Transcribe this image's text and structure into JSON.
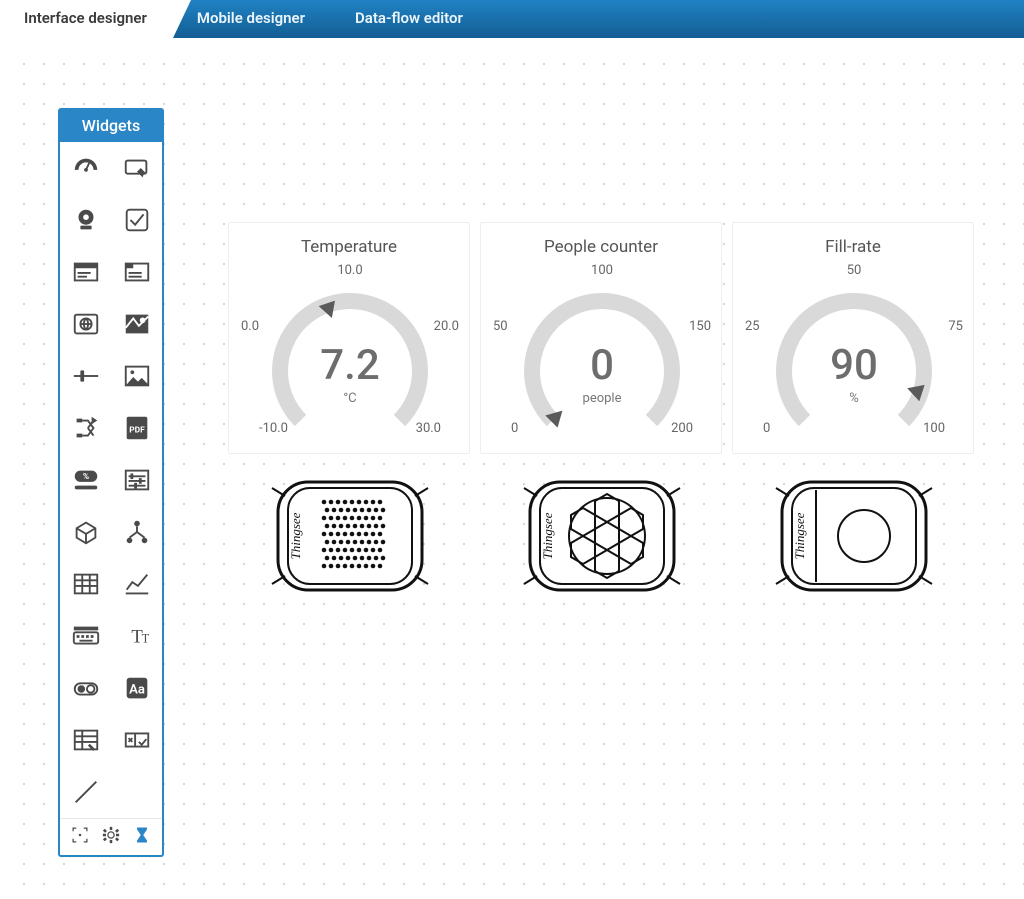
{
  "tabs": {
    "interface": "Interface designer",
    "mobile": "Mobile designer",
    "dataflow": "Data-flow editor"
  },
  "palette": {
    "title": "Widgets",
    "items": [
      "gauge-icon",
      "button-icon",
      "webcam-icon",
      "checkbox-icon",
      "text-display-icon",
      "text-area-icon",
      "web-page-icon",
      "map-icon",
      "slider-icon",
      "image-icon",
      "data-flow-icon",
      "pdf-icon",
      "percent-icon",
      "sliders-panel-icon",
      "cube-icon",
      "tree-icon",
      "table-icon",
      "chart-icon",
      "keyboard-icon",
      "text-label-icon",
      "toggle-icon",
      "font-box-icon",
      "form-table-icon",
      "form-row-icon",
      "line-icon",
      ""
    ],
    "bottom": [
      "focus-icon",
      "settings-gear-icon",
      "hourglass-icon"
    ]
  },
  "gauges": [
    {
      "title": "Temperature",
      "value": "7.2",
      "unit": "°C",
      "min": -10,
      "max": 30,
      "ticks": {
        "top": "10.0",
        "left": "0.0",
        "right": "20.0",
        "bl": "-10.0",
        "br": "30.0"
      },
      "needle_fraction": 0.43
    },
    {
      "title": "People counter",
      "value": "0",
      "unit": "people",
      "min": 0,
      "max": 200,
      "ticks": {
        "top": "100",
        "left": "50",
        "right": "150",
        "bl": "0",
        "br": "200"
      },
      "needle_fraction": 0.0
    },
    {
      "title": "Fill-rate",
      "value": "90",
      "unit": "%",
      "min": 0,
      "max": 100,
      "ticks": {
        "top": "50",
        "left": "25",
        "right": "75",
        "bl": "0",
        "br": "100"
      },
      "needle_fraction": 0.9
    }
  ],
  "device_brand": "Thingsee",
  "chart_data": [
    {
      "type": "gauge",
      "title": "Temperature",
      "min": -10,
      "max": 30,
      "value": 7.2,
      "unit": "°C",
      "ticks": [
        -10,
        0,
        10,
        20,
        30
      ]
    },
    {
      "type": "gauge",
      "title": "People counter",
      "min": 0,
      "max": 200,
      "value": 0,
      "unit": "people",
      "ticks": [
        0,
        50,
        100,
        150,
        200
      ]
    },
    {
      "type": "gauge",
      "title": "Fill-rate",
      "min": 0,
      "max": 100,
      "value": 90,
      "unit": "%",
      "ticks": [
        0,
        25,
        50,
        75,
        100
      ]
    }
  ]
}
